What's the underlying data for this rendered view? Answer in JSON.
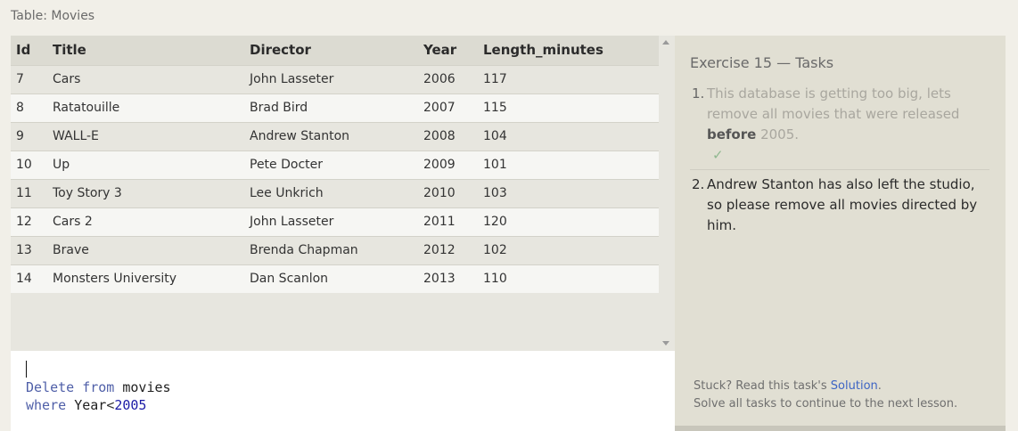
{
  "table_caption": "Table: Movies",
  "table": {
    "columns": [
      "Id",
      "Title",
      "Director",
      "Year",
      "Length_minutes"
    ],
    "rows": [
      [
        "7",
        "Cars",
        "John Lasseter",
        "2006",
        "117"
      ],
      [
        "8",
        "Ratatouille",
        "Brad Bird",
        "2007",
        "115"
      ],
      [
        "9",
        "WALL-E",
        "Andrew Stanton",
        "2008",
        "104"
      ],
      [
        "10",
        "Up",
        "Pete Docter",
        "2009",
        "101"
      ],
      [
        "11",
        "Toy Story 3",
        "Lee Unkrich",
        "2010",
        "103"
      ],
      [
        "12",
        "Cars 2",
        "John Lasseter",
        "2011",
        "120"
      ],
      [
        "13",
        "Brave",
        "Brenda Chapman",
        "2012",
        "102"
      ],
      [
        "14",
        "Monsters University",
        "Dan Scanlon",
        "2013",
        "110"
      ]
    ]
  },
  "editor": {
    "line1": {
      "kw1": "Delete",
      "kw2": "from",
      "table": "movies"
    },
    "line2": {
      "kw": "where",
      "column": "Year",
      "op": "<",
      "value": "2005"
    }
  },
  "tasks_panel": {
    "heading": "Exercise 15 — Tasks",
    "tasks": [
      {
        "number": "1.",
        "text_before": "This database is getting too big, lets remove all movies that were released ",
        "emphasis": "before",
        "text_after": " 2005.",
        "check": "✓",
        "status": "done"
      },
      {
        "number": "2.",
        "text": "Andrew Stanton has also left the studio, so please remove all movies directed by him.",
        "status": "active"
      }
    ],
    "help": {
      "prefix": "Stuck? Read this task's ",
      "link": "Solution",
      "suffix": ".",
      "line2": "Solve all tasks to continue to the next lesson."
    }
  }
}
